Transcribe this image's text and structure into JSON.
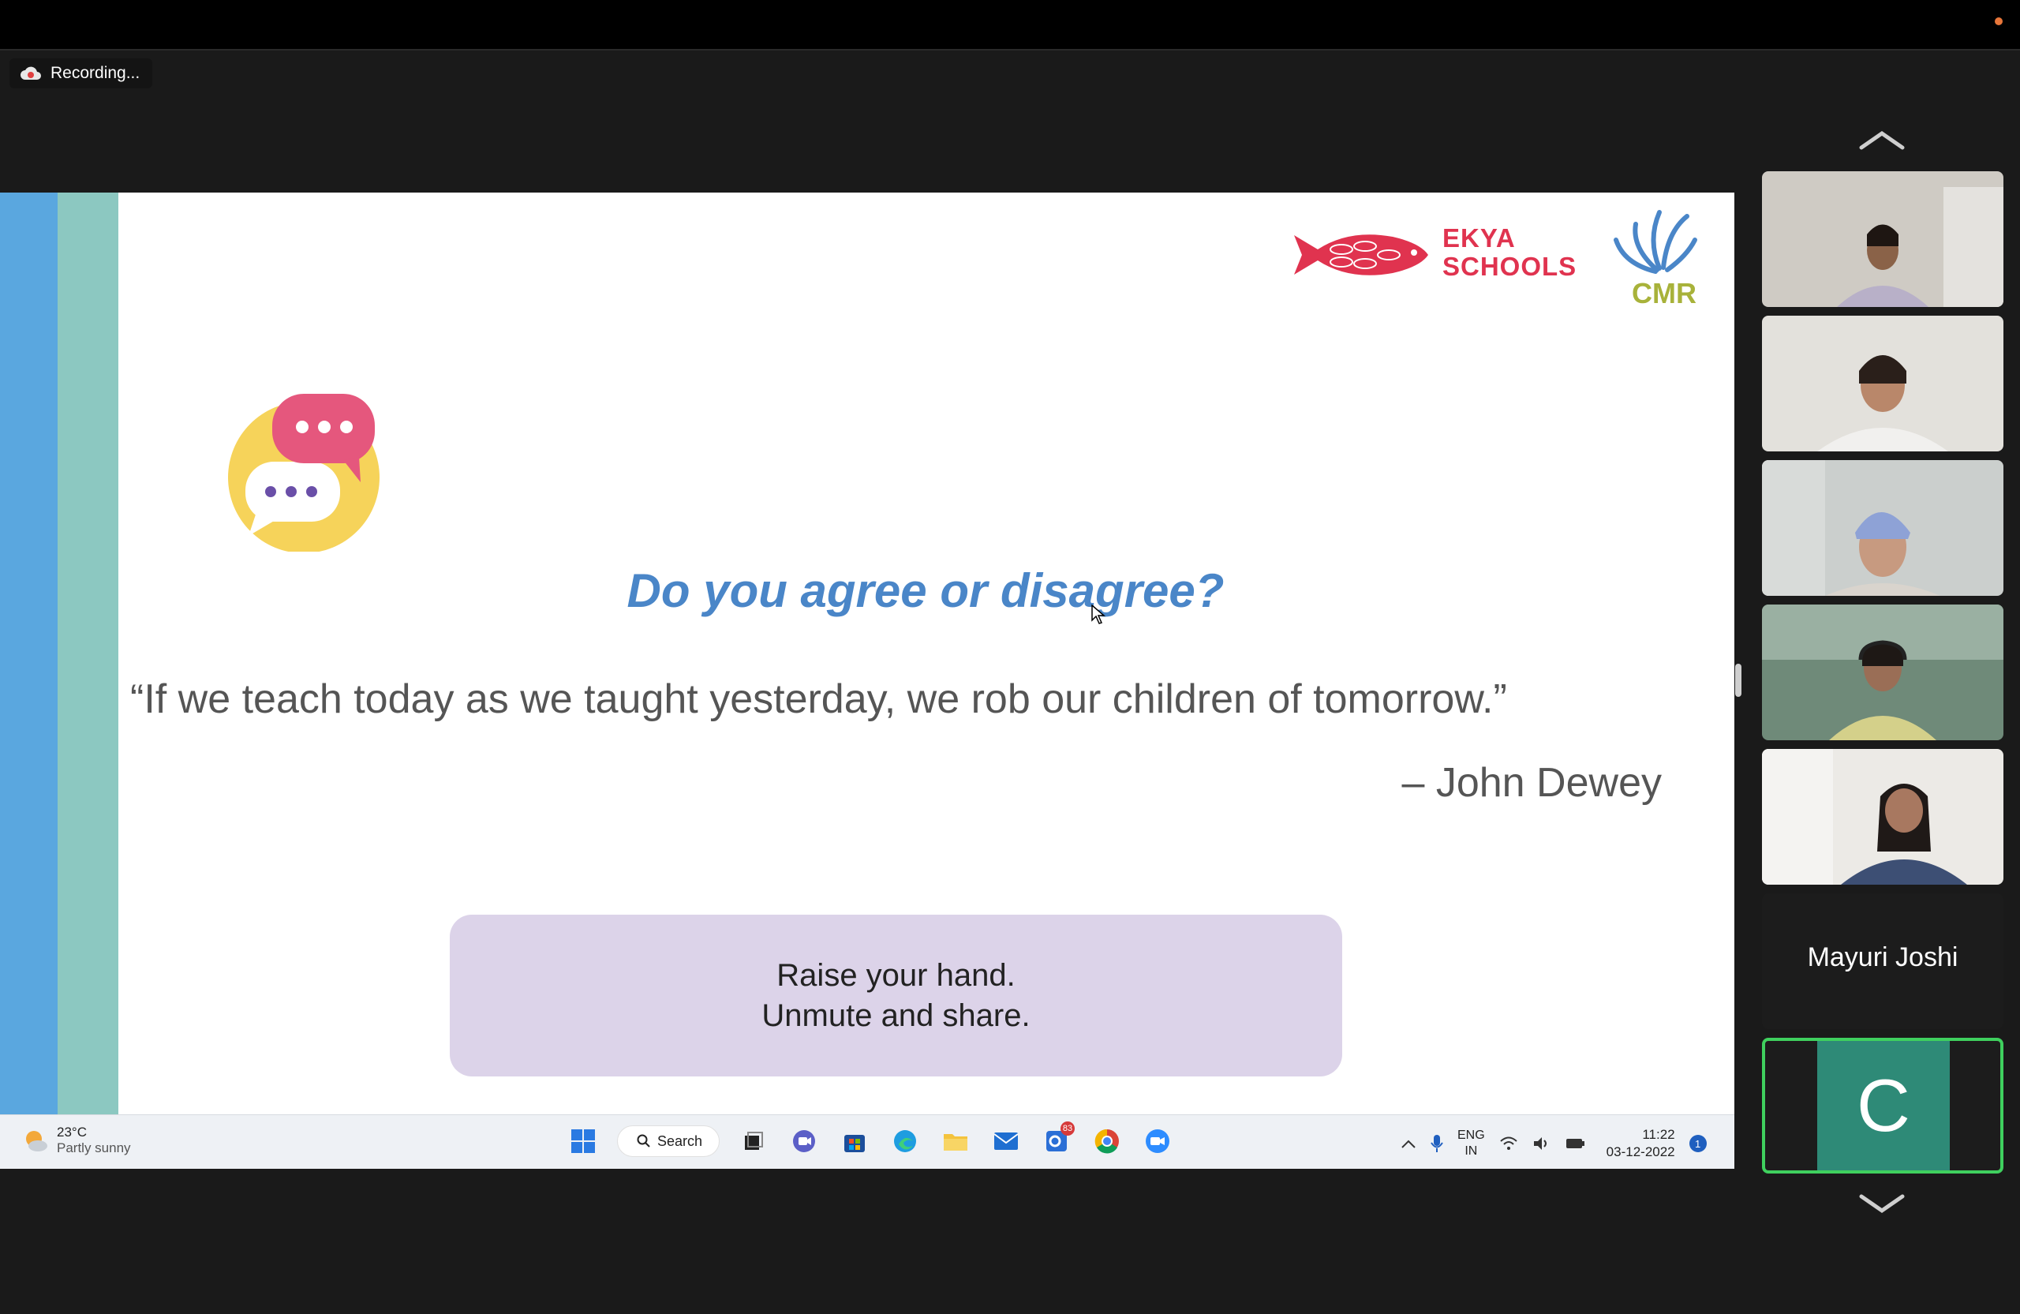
{
  "recording": {
    "label": "Recording..."
  },
  "slide": {
    "logo_text_line1": "EKYA",
    "logo_text_line2": "SCHOOLS",
    "logo_cmr": "CMR",
    "title": "Do you agree or disagree?",
    "quote": "“If we teach today as we taught yesterday, we rob our children of tomorrow.”",
    "author": "– John Dewey",
    "callout_line1": "Raise your hand.",
    "callout_line2": "Unmute and share."
  },
  "taskbar": {
    "weather_temp": "23°C",
    "weather_desc": "Partly sunny",
    "search_label": "Search",
    "lang_line1": "ENG",
    "lang_line2": "IN",
    "time": "11:22",
    "date": "03-12-2022",
    "notification_count": "1",
    "badge_count": "83"
  },
  "participants": {
    "tiles": [
      {
        "type": "video"
      },
      {
        "type": "video"
      },
      {
        "type": "video"
      },
      {
        "type": "video"
      },
      {
        "type": "video"
      }
    ],
    "named_tile": "Mayuri Joshi",
    "avatar_initial": "C"
  },
  "colors": {
    "accent_blue": "#4a86c8",
    "brand_red": "#e0334f",
    "callout_bg": "#dcd3e9",
    "active_speaker": "#3fd05e"
  }
}
